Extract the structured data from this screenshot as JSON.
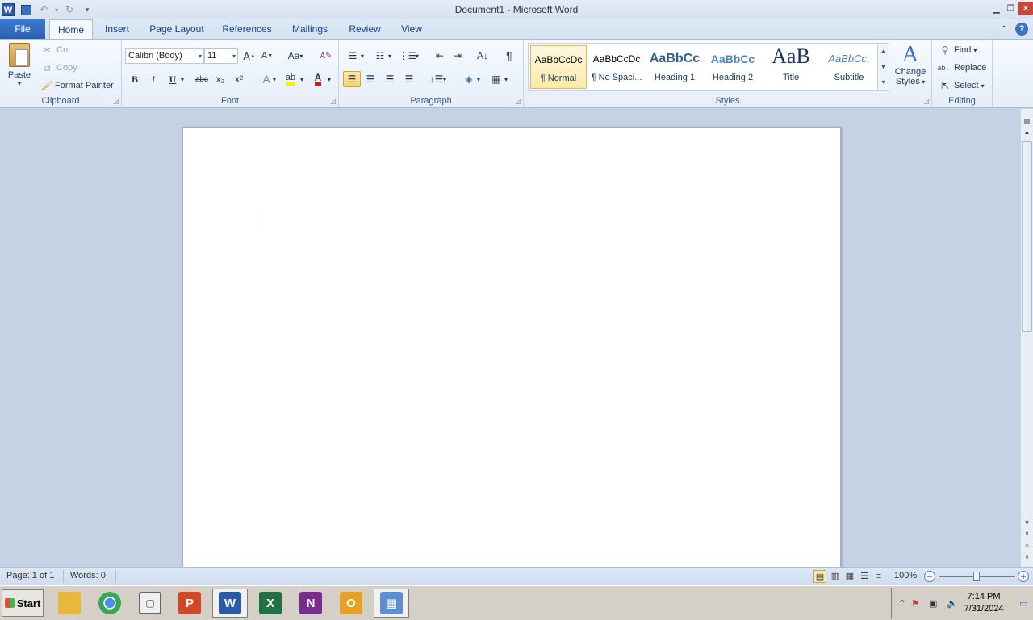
{
  "window": {
    "title": "Document1  -  Microsoft Word"
  },
  "qat": {
    "app_icon": "word-icon",
    "save": "save-icon",
    "undo": "undo-icon",
    "redo": "redo-icon",
    "customize": "customize-icon"
  },
  "tabs": [
    "File",
    "Home",
    "Insert",
    "Page Layout",
    "References",
    "Mailings",
    "Review",
    "View"
  ],
  "clipboard": {
    "paste": "Paste",
    "cut": "Cut",
    "copy": "Copy",
    "format_painter": "Format Painter",
    "label": "Clipboard"
  },
  "font": {
    "name": "Calibri (Body)",
    "size": "11",
    "label": "Font",
    "bold": "B",
    "italic": "I",
    "underline": "U",
    "strike": "abc",
    "sub": "x₂",
    "sup": "x²",
    "change_case": "Aa"
  },
  "paragraph": {
    "label": "Paragraph",
    "pilcrow": "¶"
  },
  "styles": {
    "label": "Styles",
    "items": [
      {
        "preview": "AaBbCcDc",
        "name": "¶ Normal"
      },
      {
        "preview": "AaBbCcDc",
        "name": "¶ No Spaci..."
      },
      {
        "preview": "AaBbCc",
        "name": "Heading 1"
      },
      {
        "preview": "AaBbCc",
        "name": "Heading 2"
      },
      {
        "preview": "AaB",
        "name": "Title"
      },
      {
        "preview": "AaBbCc.",
        "name": "Subtitle"
      }
    ],
    "change_styles_1": "Change",
    "change_styles_2": "Styles"
  },
  "editing": {
    "label": "Editing",
    "find": "Find",
    "replace": "Replace",
    "select": "Select"
  },
  "status": {
    "page": "Page: 1 of 1",
    "words": "Words: 0",
    "zoom": "100%"
  },
  "taskbar": {
    "start": "Start",
    "time": "7:14 PM",
    "date": "7/31/2024"
  }
}
